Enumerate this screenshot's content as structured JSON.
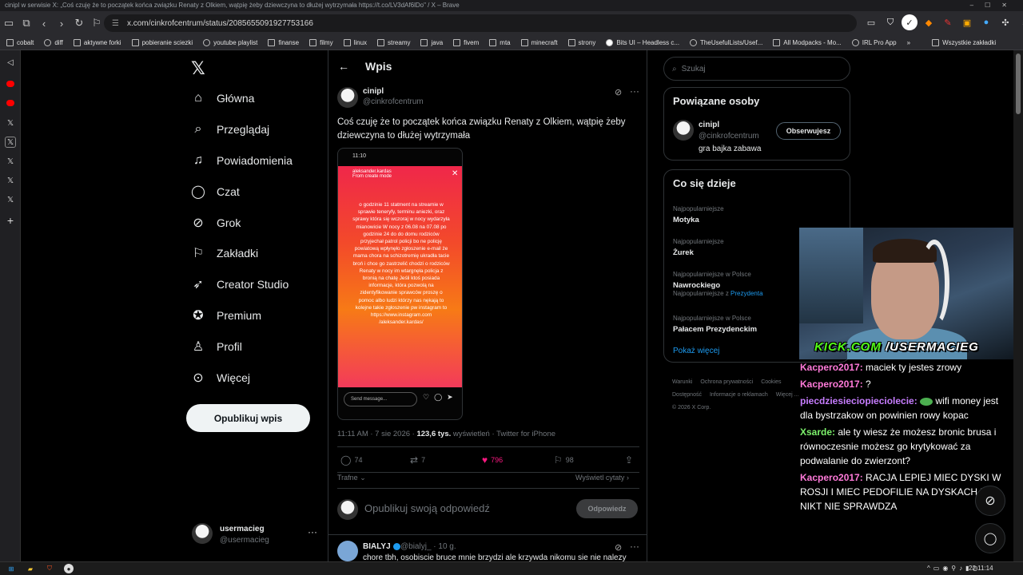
{
  "window": {
    "title": "cinipl w serwisie X: „Coś czuję że to początek końca związku Renaty z Olkiem, wątpię żeby dziewczyna to dłużej wytrzymała https://t.co/LV3dAf6lDo\" / X – Brave",
    "url": "x.com/cinkrofcentrum/status/2085655091927753166"
  },
  "bookmarks": [
    "cobalt",
    "diff",
    "aktywne forki",
    "pobieranie sciezki",
    "youtube playlist",
    "finanse",
    "filmy",
    "linux",
    "streamy",
    "java",
    "fivem",
    "mta",
    "minecraft",
    "strony",
    "Bits UI – Headless c...",
    "TheUsefulLists/Usef...",
    "All Modpacks - Mo...",
    "IRL Pro App",
    "Wszystkie zakładki"
  ],
  "nav": {
    "items": [
      {
        "label": "Główna",
        "icon": "home-icon"
      },
      {
        "label": "Przeglądaj",
        "icon": "search-icon"
      },
      {
        "label": "Powiadomienia",
        "icon": "bell-icon"
      },
      {
        "label": "Czat",
        "icon": "chat-icon"
      },
      {
        "label": "Grok",
        "icon": "grok-icon"
      },
      {
        "label": "Zakładki",
        "icon": "bookmark-icon"
      },
      {
        "label": "Creator Studio",
        "icon": "rocket-icon"
      },
      {
        "label": "Premium",
        "icon": "verified-icon"
      },
      {
        "label": "Profil",
        "icon": "person-icon"
      },
      {
        "label": "Więcej",
        "icon": "more-icon"
      }
    ],
    "post_button": "Opublikuj wpis",
    "account": {
      "name": "usermacieg",
      "handle": "@usermacieg"
    }
  },
  "header": {
    "title": "Wpis"
  },
  "tweet": {
    "name": "cinipl",
    "handle": "@cinkrofcentrum",
    "text": "Coś czuję że to początek końca związku Renaty z Olkiem, wątpię żeby dziewczyna to dłużej wytrzymała",
    "story": {
      "time": "11:10",
      "user": "aleksander.kardas",
      "sub": "From create mode",
      "body": "o godzinie 11 statment na streamie w sprawie teneryfy, terminu aniezki, oraz sprawy która się wczoraj w nocy wydarzyła mianowicie W nocy z 06.08 na 07.08 po godzinie 24 do do domu rodziców przyjechał patrol policji bo ne policję powiatową wpłynęło zgłoszenie e-mail że mama chora na schizotremię ukradła tacie broń i chce go zastrzelić chodzi o rodziców Renaty w nocy im wtargnęła policja z bronią na chatę Jeśli ktoś posiada informacje, która pozwolą na zidentyfikowanie sprawców proszę o pomoc albo ludzi którzy nas nękają to kolejne takie zgłoszenie pw instagram to https://www.instagram.com /aleksander.kardas/",
      "send_placeholder": "Send message..."
    },
    "time": "11:11 AM · 7 sie 2026 · ",
    "views_count": "123,6 tys.",
    "views_label": " wyświetleń · Twitter for iPhone",
    "replies": "74",
    "reposts": "7",
    "likes": "796",
    "bookmarks": "98",
    "sort_label": "Trafne",
    "quotes_label": "Wyświetl cytaty"
  },
  "reply_box": {
    "placeholder": "Opublikuj swoją odpowiedź",
    "button": "Odpowiedz"
  },
  "reply2": {
    "name": "BIALYJ",
    "handle": "@bialyj_ · 10 g.",
    "text": "chore tbh, osobiscie bruce mnie brzydzi ale krzywda nikomu sie nie nalezy"
  },
  "right": {
    "search_placeholder": "Szukaj",
    "related_title": "Powiązane osoby",
    "related": {
      "name": "cinipl",
      "handle": "@cinkrofcentrum",
      "bio": "gra bajka zabawa",
      "button": "Obserwujesz"
    },
    "trends_title": "Co się dzieje",
    "trends": [
      {
        "context": "Najpopularniejsze",
        "name": "Motyka",
        "extra": ""
      },
      {
        "context": "Najpopularniejsze",
        "name": "Żurek",
        "extra": ""
      },
      {
        "context": "Najpopularniejsze w Polsce",
        "name": "Nawrockiego",
        "extra_label": "Najpopularniejsze z ",
        "extra": "Prezydenta"
      },
      {
        "context": "Najpopularniejsze w Polsce",
        "name": "Pałacem Prezydenckim",
        "extra": ""
      }
    ],
    "show_more": "Pokaż więcej",
    "footer": [
      "Warunki",
      "Ochrona prywatności",
      "Cookies",
      "Dostępność",
      "Informacje o reklamach",
      "Więcej ...",
      "© 2026 X Corp."
    ]
  },
  "stream": {
    "kick_prefix": "KICK.COM",
    "kick_user": "/USERMACIEG",
    "chat": [
      {
        "user": "Kacpero2017:",
        "msg": " maciek ty jestes zrowy",
        "cls": "u1"
      },
      {
        "user": "Kacpero2017:",
        "msg": " ?",
        "cls": "u1"
      },
      {
        "user": "piecdziesieciopieciolecie:",
        "msg": " wifi money jest dla bystrzakow on powinien rowy kopac",
        "cls": "u2"
      },
      {
        "user": "Xsarde:",
        "msg": " ale ty wiesz że możesz bronic brusa i równoczesnie możesz go krytykować za podwalanie do zwierzont?",
        "cls": "u3"
      },
      {
        "user": "Kacpero2017:",
        "msg": " RACJA LEPIEJ MIEC DYSKI W ROSJI I MIEC PEDOFILIE NA DYSKACH BO NIKT NIE SPRAWDZA",
        "cls": "u1"
      }
    ]
  },
  "taskbar": {
    "clock": "22:11:14"
  }
}
